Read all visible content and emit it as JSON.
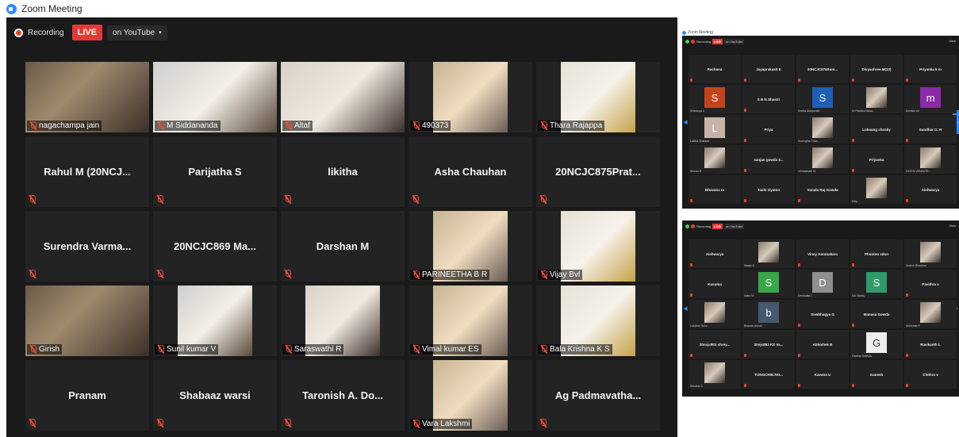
{
  "window": {
    "title": "Zoom Meeting"
  },
  "toolbar": {
    "recording_label": "Recording",
    "live_label": "LIVE",
    "youtube_label": "on YouTube",
    "caret": "▾"
  },
  "main": {
    "participants": [
      {
        "name": "nagachampa jain",
        "video": true,
        "active": true
      },
      {
        "name": "M Siddananda",
        "video": true
      },
      {
        "name": "Altaf",
        "video": true
      },
      {
        "name": "490373",
        "video": true
      },
      {
        "name": "Thara Rajappa",
        "video": true
      },
      {
        "name": "Rahul M (20NCJ...",
        "video": false
      },
      {
        "name": "Parijatha S",
        "video": false
      },
      {
        "name": "likitha",
        "video": false
      },
      {
        "name": "Asha Chauhan",
        "video": false
      },
      {
        "name": "20NCJC875Prat...",
        "video": false
      },
      {
        "name": "Surendra  Varma...",
        "video": false
      },
      {
        "name": "20NCJC869  Ma...",
        "video": false
      },
      {
        "name": "Darshan M",
        "video": false
      },
      {
        "name": "PARINEETHA B R",
        "video": true
      },
      {
        "name": "Vijay Bvl",
        "video": true
      },
      {
        "name": "Girish",
        "video": true
      },
      {
        "name": "Sunil kumar V",
        "video": true
      },
      {
        "name": "Saraswathi R",
        "video": true
      },
      {
        "name": "Vimal kumar ES",
        "video": true
      },
      {
        "name": "Bala Krishna K S",
        "video": true
      },
      {
        "name": "Pranam",
        "video": false
      },
      {
        "name": "Shabaaz warsi",
        "video": false
      },
      {
        "name": "Taronish  A. Do...",
        "video": false
      },
      {
        "name": "Vara Lakshmi",
        "video": true
      },
      {
        "name": "Ag  Padmavatha...",
        "video": false
      }
    ]
  },
  "mini1": {
    "title": "Zoom Meeting",
    "view_label": "View",
    "tiles": [
      {
        "name": "Rachana"
      },
      {
        "name": "Jayaprakash E"
      },
      {
        "name": "20NCJC876Suni..."
      },
      {
        "name": "Divyashree.M(10)"
      },
      {
        "name": "Priyanka k m"
      },
      {
        "avatar": "S",
        "color": "#c4441a",
        "label": "Sharanya s"
      },
      {
        "name": "S B N Shastri"
      },
      {
        "avatar": "S",
        "color": "#1c5fb5",
        "label": "Sneha Manjunath"
      },
      {
        "photo": true,
        "label": "Dr.Pawana Basa..."
      },
      {
        "avatar": "m",
        "color": "#8a2aa8",
        "label": "Monika shi"
      },
      {
        "avatar": "L",
        "color": "#c6b3a8",
        "label": "Lalitha Shankar"
      },
      {
        "name": "Priya"
      },
      {
        "photo": true,
        "label": "Sowmyha Chan..."
      },
      {
        "name": "Lobsang chosky"
      },
      {
        "name": "Sundhar G. R"
      },
      {
        "photo": true,
        "label": "Shivan H"
      },
      {
        "name": "sanjan gowda 2..."
      },
      {
        "photo": true,
        "label": "Vishwanath M"
      },
      {
        "name": "Priyanka"
      },
      {
        "photo": true,
        "label": "DEEPA VENKATE..."
      },
      {
        "name": "Bhavana m"
      },
      {
        "name": "Tashi Gyatso"
      },
      {
        "name": "Varada Raj Gowda"
      },
      {
        "photo": true,
        "label": "Dilip"
      },
      {
        "name": "Aishwarya"
      }
    ]
  },
  "mini2": {
    "view_label": "View",
    "tiles": [
      {
        "name": "Aishwarya"
      },
      {
        "photo": true,
        "label": "Manju S"
      },
      {
        "name": "Vinay Karanakara"
      },
      {
        "name": "Phuntso sdon"
      },
      {
        "photo": true,
        "label": "Akarsh Bhushan"
      },
      {
        "name": "Kusuma"
      },
      {
        "avatar": "S",
        "color": "#3aa64a",
        "label": "Indra M"
      },
      {
        "avatar": "D",
        "color": "#8e8e8e",
        "label": "Devikalaa L"
      },
      {
        "avatar": "S",
        "color": "#2e9a6a",
        "label": "Sai Mahiq"
      },
      {
        "name": "Pavithra s"
      },
      {
        "photo": true,
        "label": "Lakshmi Sura..."
      },
      {
        "avatar": "b",
        "color": "#455a6e",
        "label": "Bharath Ashok"
      },
      {
        "name": "Sowbhagya G"
      },
      {
        "name": "Manasa Gowda"
      },
      {
        "photo": true,
        "label": "Abhishek R"
      },
      {
        "name": "20ncjc901 shrey..."
      },
      {
        "name": "20njc883 KS Va..."
      },
      {
        "name": "Abhishek B"
      },
      {
        "avatar": "G",
        "color": "#eeeeee",
        "label": "Geetha Srinivas"
      },
      {
        "name": "Ravikanth L"
      },
      {
        "photo": true,
        "label": "Shrutha S"
      },
      {
        "name": "TONGCHIN  NO..."
      },
      {
        "name": "Kavana U"
      },
      {
        "name": "Ganesh"
      },
      {
        "name": "Chithra v"
      }
    ]
  }
}
